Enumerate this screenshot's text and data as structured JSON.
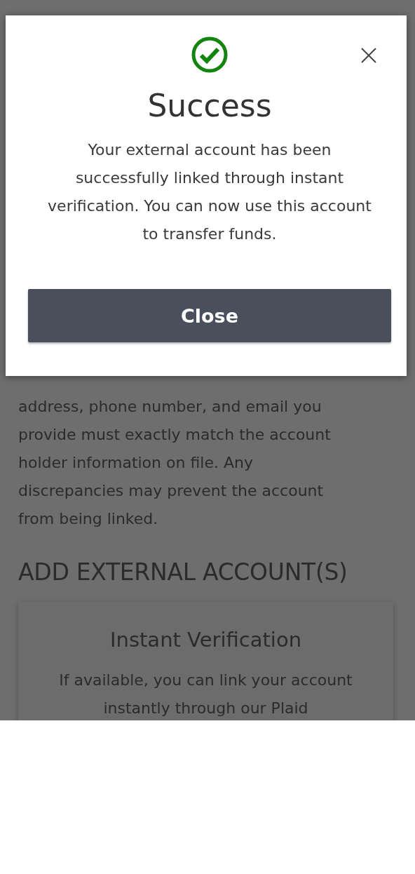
{
  "background_page": {
    "notice": "address, phone number, and email you provide must exactly match the account holder information on file. Any discrepancies may prevent the account from being linked.",
    "section_heading": "ADD EXTERNAL ACCOUNT(S)",
    "card": {
      "title": "Instant Verification",
      "text": "If available, you can link your account instantly through our Plaid"
    }
  },
  "modal": {
    "title": "Success",
    "message": "Your external account has been successfully linked through instant verification. You can now use this account to transfer funds.",
    "button": "Close"
  }
}
